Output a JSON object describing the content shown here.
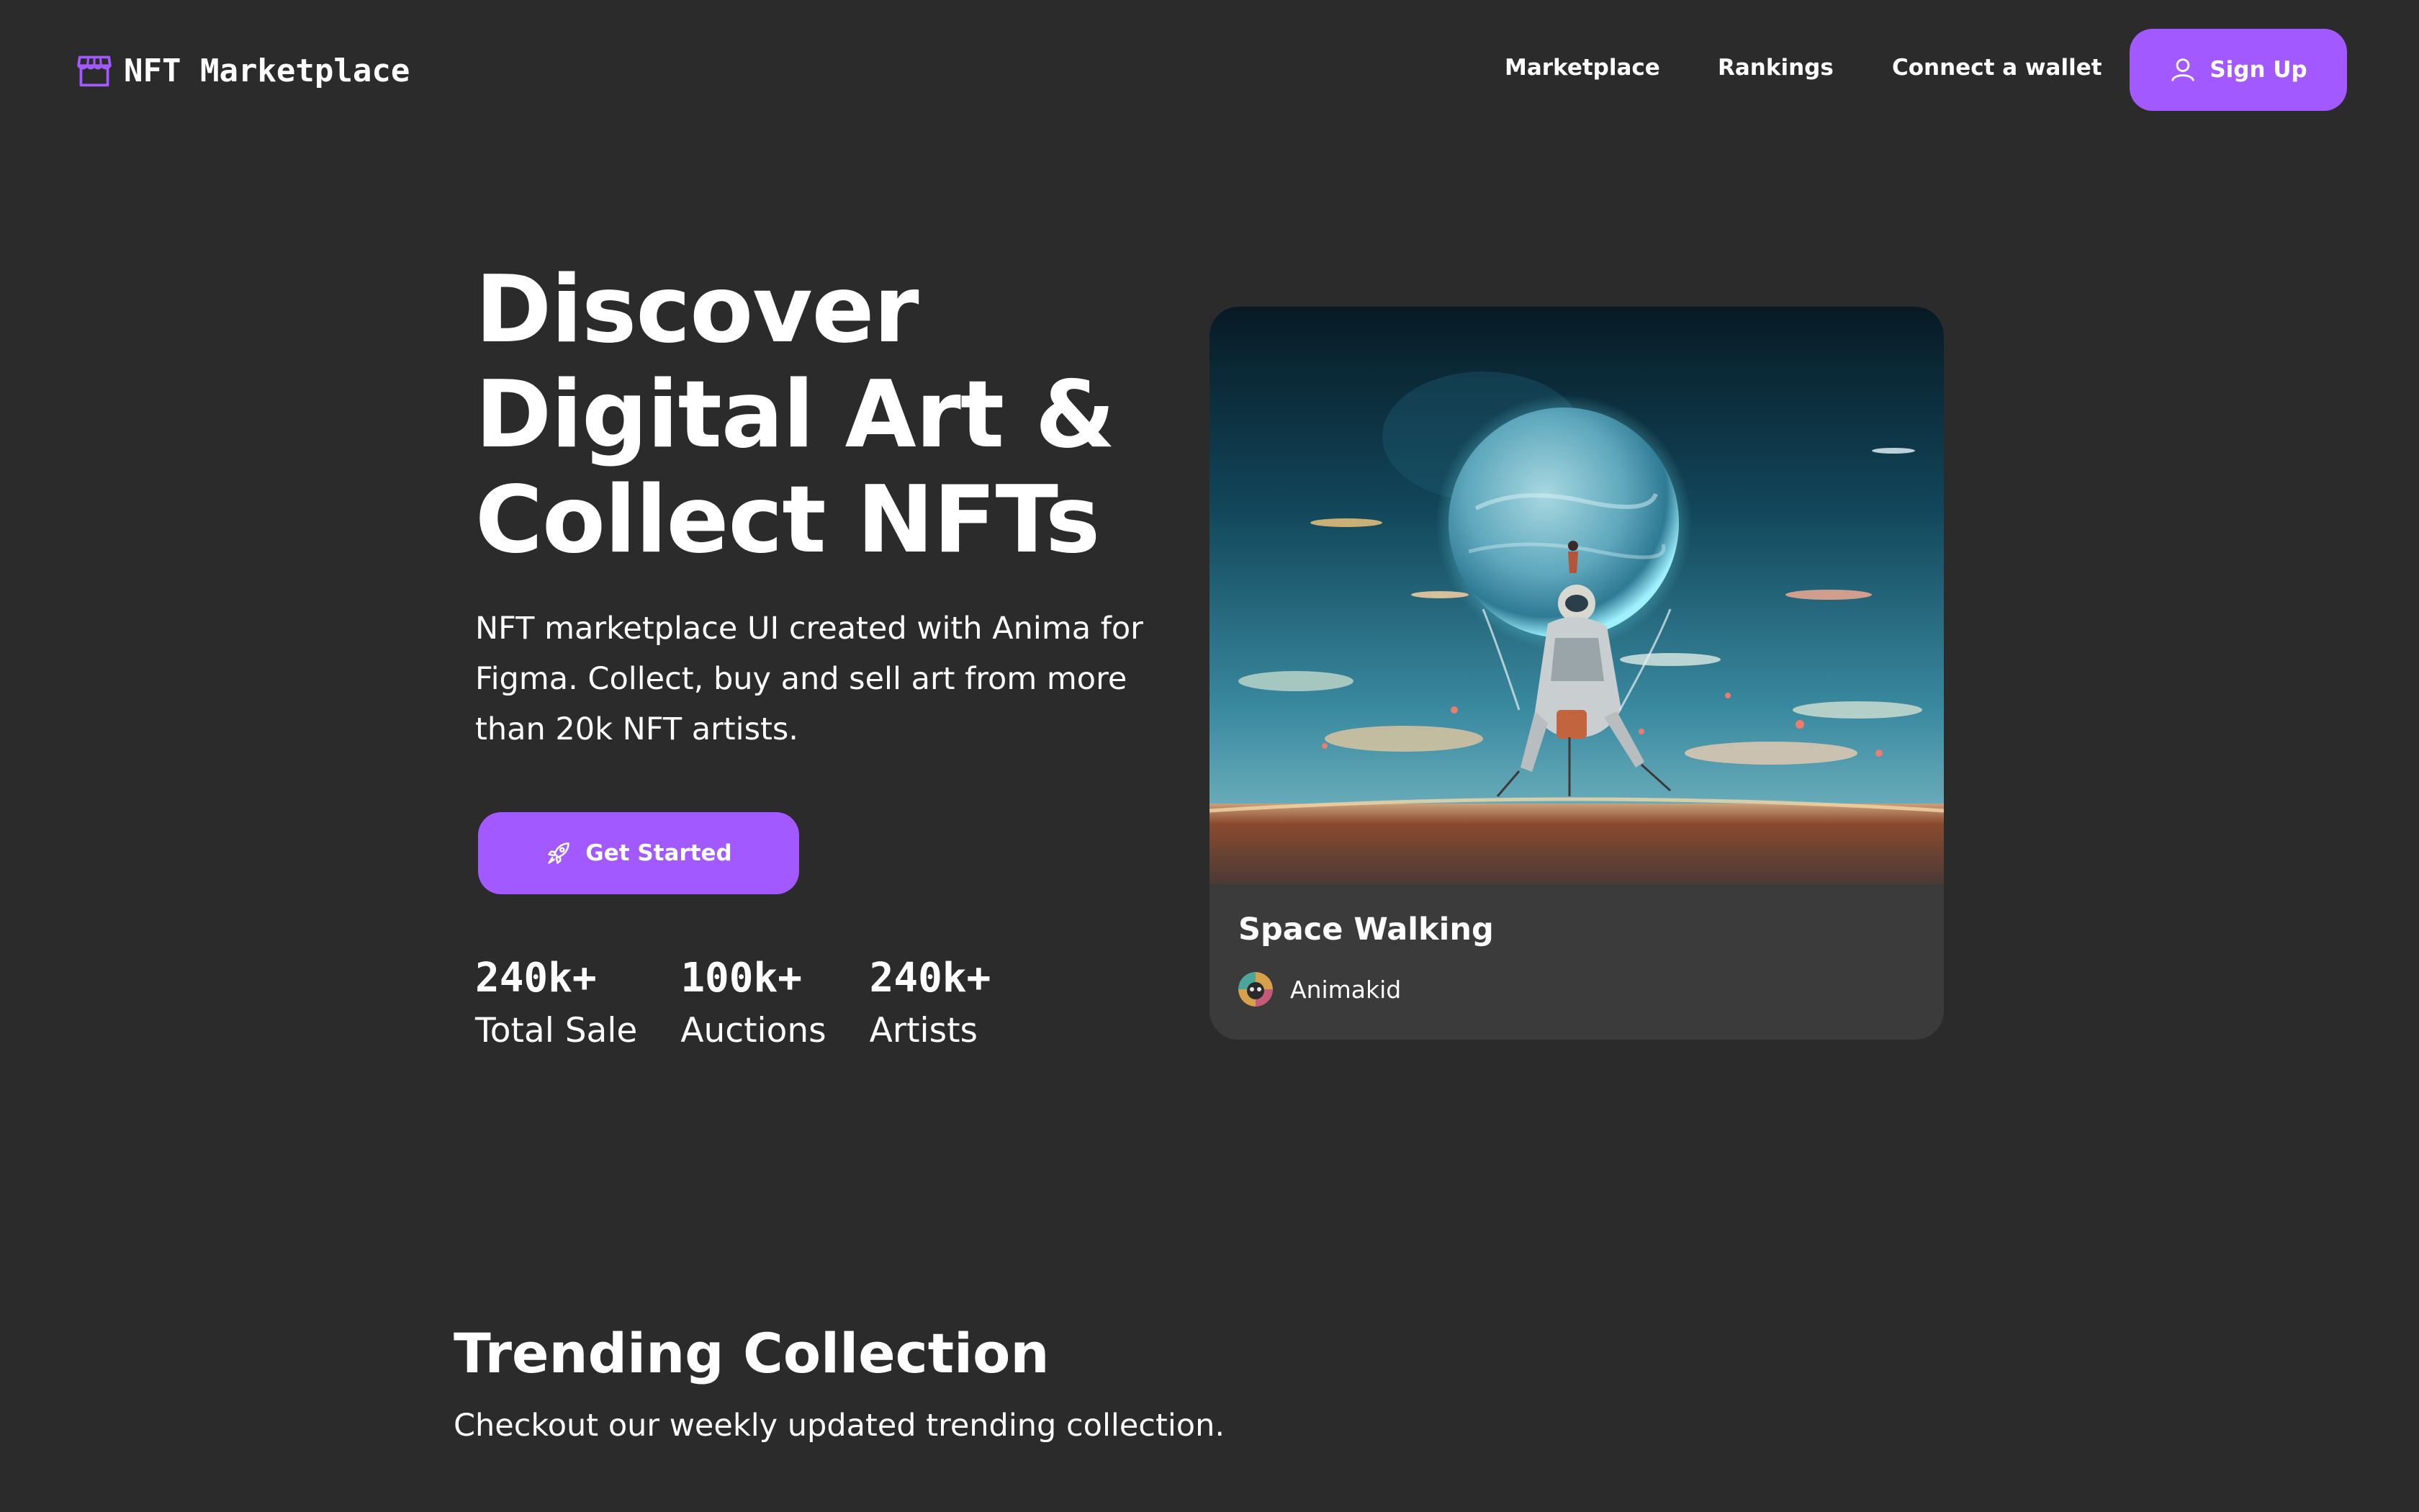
{
  "brand": {
    "name": "NFT Marketplace",
    "icon": "storefront-icon",
    "accent_color": "#a259ff",
    "background_color": "#2b2b2b",
    "card_color": "#3b3b3b"
  },
  "nav": {
    "items": [
      {
        "label": "Marketplace"
      },
      {
        "label": "Rankings"
      },
      {
        "label": "Connect a wallet"
      }
    ],
    "signup": {
      "label": "Sign Up",
      "icon": "user-icon"
    }
  },
  "hero": {
    "title_lines": [
      "Discover",
      "Digital Art &",
      "Collect NFTs"
    ],
    "description": "NFT marketplace UI created with Anima for Figma. Collect, buy and sell art from more than 20k NFT artists.",
    "cta": {
      "label": "Get Started",
      "icon": "rocket-icon"
    },
    "stats": [
      {
        "value": "240k+",
        "label": "Total Sale"
      },
      {
        "value": "100k+",
        "label": "Auctions"
      },
      {
        "value": "240k+",
        "label": "Artists"
      }
    ]
  },
  "highlight": {
    "title": "Space Walking",
    "artist": "Animakid",
    "artwork": "astronaut-planet-artwork",
    "avatar": "artist-avatar"
  },
  "trending": {
    "title": "Trending Collection",
    "subtitle": "Checkout our weekly updated trending collection."
  }
}
